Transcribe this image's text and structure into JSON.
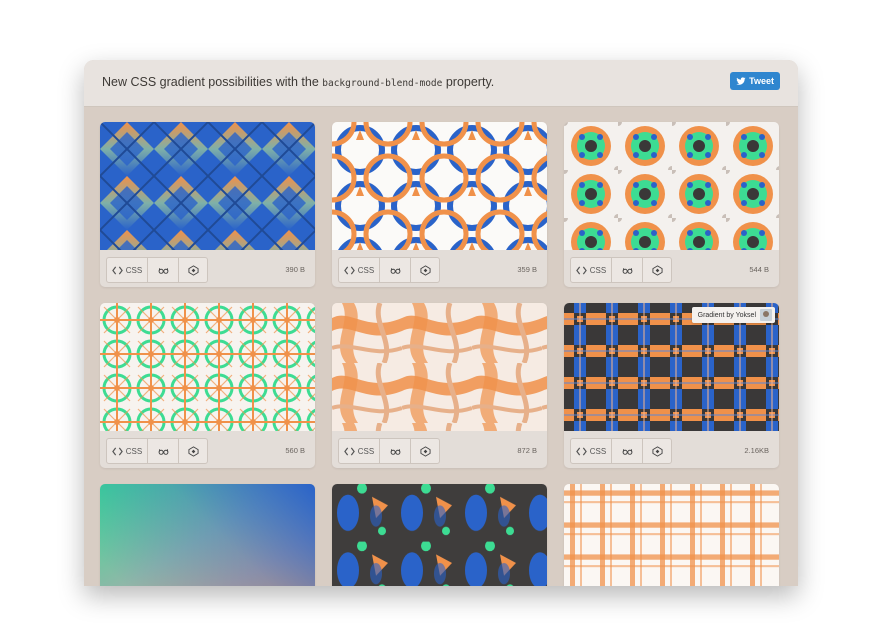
{
  "header": {
    "title_before": "New CSS gradient possibilities with the ",
    "title_code": "background-blend-mode",
    "title_after": " property.",
    "tweet_label": "Tweet"
  },
  "colors": {
    "orange": "#f0914a",
    "blue": "#2a63c9",
    "green": "#3ddc93",
    "dark": "#3a3838",
    "header_bg": "#e8e3df",
    "page_bg": "#d8cdc4",
    "tweet_blue": "#2f86cf"
  },
  "cards": [
    {
      "css_label": "CSS",
      "size": "390 B"
    },
    {
      "css_label": "CSS",
      "size": "359 B"
    },
    {
      "css_label": "CSS",
      "size": "544 B"
    },
    {
      "css_label": "CSS",
      "size": "560 B"
    },
    {
      "css_label": "CSS",
      "size": "872 B"
    },
    {
      "css_label": "CSS",
      "size": "2.16KB",
      "credit": "Gradient by Yoksel"
    }
  ],
  "icons": {
    "css": "code-brackets-icon",
    "view": "glasses-icon",
    "pen": "codepen-icon",
    "tweet": "twitter-bird-icon"
  }
}
